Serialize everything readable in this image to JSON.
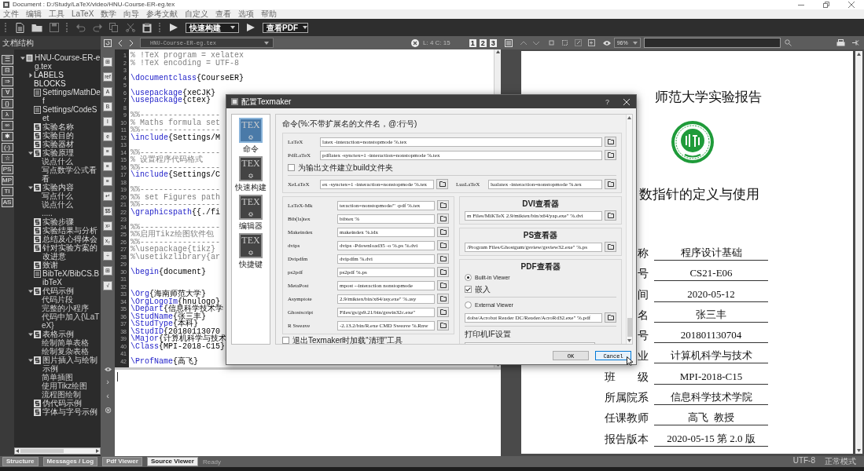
{
  "window": {
    "title": "Document : D:/Study/LaTeX/video/HNU-Course-ER-eg.tex"
  },
  "menu": [
    "文件",
    "编辑",
    "工具",
    "LaTeX",
    "数学",
    "向导",
    "参考文献",
    "自定义",
    "查看",
    "选项",
    "帮助"
  ],
  "toolbar": {
    "build_command": "快速构建",
    "view_command": "查看PDF"
  },
  "tabbar": {
    "file_tab": "HNU-Course-ER-eg.tex",
    "cursor_position": "L: 4 C: 15",
    "page_layouts": [
      "1",
      "2",
      "3"
    ],
    "zoom": "96%"
  },
  "structure": {
    "title": "文档结构",
    "symbols": [
      "☰",
      "⊟",
      "⇒",
      "∀",
      "{}",
      "λ",
      "∞",
      "✱",
      "(·)",
      "☆",
      "PS",
      "MP",
      "TI",
      "AS"
    ],
    "tree": [
      {
        "label": "HNU-Course-ER-eg.tex",
        "kind": "file",
        "expanded": true,
        "children": [
          {
            "label": "LABELS",
            "kind": "group",
            "expanded": false
          },
          {
            "label": "BLOCKS",
            "kind": "group"
          },
          {
            "label": "Settings/MathDef",
            "kind": "include"
          },
          {
            "label": "Settings/CodeSet",
            "kind": "include"
          },
          {
            "label": "实验名称",
            "kind": "section"
          },
          {
            "label": "实验目的",
            "kind": "section"
          },
          {
            "label": "实验器材",
            "kind": "section"
          },
          {
            "label": "实验原理",
            "kind": "section",
            "expanded": true,
            "children": [
              {
                "label": "说点什么",
                "kind": "item"
              },
              {
                "label": "写点数学公式看看",
                "kind": "item"
              }
            ]
          },
          {
            "label": "实验内容",
            "kind": "section",
            "expanded": true,
            "children": [
              {
                "label": "写点什么",
                "kind": "item"
              },
              {
                "label": "说点什么",
                "kind": "item"
              },
              {
                "label": ".....",
                "kind": "item"
              }
            ]
          },
          {
            "label": "实验步骤",
            "kind": "section"
          },
          {
            "label": "实验结果与分析",
            "kind": "section"
          },
          {
            "label": "总结及心得体会",
            "kind": "section"
          },
          {
            "label": "针对实验方案的改进意",
            "kind": "section"
          },
          {
            "label": "致谢",
            "kind": "section"
          },
          {
            "label": "BibTeX/BibCS.BibTeX",
            "kind": "include"
          },
          {
            "label": "代码示例",
            "kind": "section",
            "expanded": true,
            "children": [
              {
                "label": "代码片段",
                "kind": "item"
              },
              {
                "label": "完整的小程序",
                "kind": "item"
              },
              {
                "label": "代码中加入{\\LaTeX}",
                "kind": "item"
              }
            ]
          },
          {
            "label": "表格示例",
            "kind": "section",
            "expanded": true,
            "children": [
              {
                "label": "绘制简单表格",
                "kind": "item"
              },
              {
                "label": "绘制复杂表格",
                "kind": "item"
              }
            ]
          },
          {
            "label": "图片插入与绘制示例",
            "kind": "section",
            "expanded": true,
            "children": [
              {
                "label": "简单插图",
                "kind": "item"
              },
              {
                "label": "使用Tikz绘图",
                "kind": "item"
              },
              {
                "label": "流程图绘制",
                "kind": "item"
              }
            ]
          },
          {
            "label": "伪代码示例",
            "kind": "section"
          },
          {
            "label": "字体与字号示例",
            "kind": "section"
          }
        ]
      }
    ]
  },
  "editor_strip": {
    "tools": [
      "⊞",
      "ref",
      "A",
      "B",
      "I",
      "e",
      "≡",
      "≡",
      "≡",
      "↵",
      "$$",
      "x²",
      "x₂",
      "÷",
      "⊞",
      "√"
    ],
    "panel_toggles": [
      "›",
      "‹",
      "⊗"
    ]
  },
  "editor": {
    "lines": [
      {
        "n": "1",
        "t": "% !TeX program = xelatex",
        "kind": "comment"
      },
      {
        "n": "2",
        "t": "% !TeX encoding = UTF-8",
        "kind": "comment"
      },
      {
        "n": "3"
      },
      {
        "n": "4",
        "t": "\\documentclass{CourseER}",
        "kind": "command"
      },
      {
        "n": "5"
      },
      {
        "n": "6",
        "t": "\\usepackage{xeCJK}",
        "kind": "command"
      },
      {
        "n": "7",
        "t": "\\usepackage{ctex}",
        "kind": "command"
      },
      {
        "n": "8"
      },
      {
        "n": "9",
        "t": "%%-----------------",
        "kind": "comment"
      },
      {
        "n": "10",
        "t": "% Maths formula set",
        "kind": "comment"
      },
      {
        "n": "11",
        "t": "%%-----------------",
        "kind": "comment"
      },
      {
        "n": "12",
        "t": "\\include{Settings/M",
        "kind": "command"
      },
      {
        "n": "13"
      },
      {
        "n": "14",
        "t": "%%-----------------",
        "kind": "comment"
      },
      {
        "n": "15",
        "t": "% 设置程序代码格式",
        "kind": "comment"
      },
      {
        "n": "16",
        "t": "%%-----------------",
        "kind": "comment"
      },
      {
        "n": "17",
        "t": "\\include{Settings/C",
        "kind": "command"
      },
      {
        "n": "18"
      },
      {
        "n": "19",
        "t": "%%-----------------",
        "kind": "comment"
      },
      {
        "n": "20",
        "t": "%% set Figures path",
        "kind": "comment"
      },
      {
        "n": "21",
        "t": "%%-----------------",
        "kind": "comment"
      },
      {
        "n": "22",
        "t": "\\graphicspath{{./fi",
        "kind": "command"
      },
      {
        "n": "23"
      },
      {
        "n": "24",
        "t": "%%-----------------",
        "kind": "comment"
      },
      {
        "n": "25",
        "t": "%%启用Tikz绘图软件包",
        "kind": "comment"
      },
      {
        "n": "26",
        "t": "%%-----------------",
        "kind": "comment"
      },
      {
        "n": "27",
        "t": "%\\usepackage{tikz}",
        "kind": "comment"
      },
      {
        "n": "28",
        "t": "%\\usetikzlibrary{ar",
        "kind": "comment"
      },
      {
        "n": "29"
      },
      {
        "n": "30",
        "t": "\\begin{document}",
        "kind": "command"
      },
      {
        "n": "31"
      },
      {
        "n": "32"
      },
      {
        "n": "33",
        "t": "\\Org{海南师范大学}",
        "kind": "command"
      },
      {
        "n": "34",
        "t": "\\OrgLogoIm{hnulogo}",
        "kind": "command"
      },
      {
        "n": "35",
        "t": "\\Depart{信息科学技术学",
        "kind": "command"
      },
      {
        "n": "36",
        "t": "\\StudName{张三丰}",
        "kind": "command"
      },
      {
        "n": "37",
        "t": "\\StudType{本科}",
        "kind": "command"
      },
      {
        "n": "38",
        "t": "\\StudID{20180113070",
        "kind": "command"
      },
      {
        "n": "39",
        "t": "\\Major{计算机科学与技术",
        "kind": "command"
      },
      {
        "n": "40",
        "t": "\\Class{MPI-2018-C15}",
        "kind": "command"
      },
      {
        "n": "41"
      },
      {
        "n": "42",
        "t": "\\ProfName{高飞}",
        "kind": "command"
      }
    ]
  },
  "pdf_page": {
    "title": "师范大学实验报告",
    "subtitle": "数指针的定义与使用",
    "fields": [
      {
        "label": "称",
        "value": "程序设计基础"
      },
      {
        "label": "号",
        "value": "CS21-E06"
      },
      {
        "label": "间",
        "value": "2020-05-12"
      },
      {
        "label": "名",
        "value": "张三丰"
      },
      {
        "label": "号",
        "value": "201801130704"
      },
      {
        "label": "业",
        "value": "计算机科学与技术"
      },
      {
        "label": "班　　级",
        "value": "MPI-2018-C15"
      },
      {
        "label": "所属院系",
        "value": "信息科学技术学院"
      },
      {
        "label": "任课教师",
        "value": "高飞  教授"
      },
      {
        "label": "报告版本",
        "value": "2020-05-15 第 2.0 版"
      }
    ]
  },
  "dialog": {
    "title": "配置Texmaker",
    "help": "?",
    "categories": [
      {
        "label": "命令",
        "logo": "TEX",
        "selected": true
      },
      {
        "label": "快速构建",
        "logo": "TEX",
        "selected": false
      },
      {
        "label": "编辑器",
        "logo": "TEX",
        "selected": false
      },
      {
        "label": "快捷键",
        "logo": "TEX",
        "selected": false
      }
    ],
    "heading": "命令(%:不带扩展名的文件名，@:行号)",
    "main_commands": [
      {
        "label": "LaTeX",
        "value": "latex -interaction=nonstopmode %.tex"
      },
      {
        "label": "PdfLaTeX",
        "value": "pdflatex -synctex=1 -interaction=nonstopmode %.tex"
      }
    ],
    "build_folder": {
      "label": "为输出文件建立build文件夹",
      "checked": false
    },
    "engines": [
      {
        "label": "XeLaTeX",
        "value": "ex -synctex=1 -interaction=nonstopmode %.tex"
      },
      {
        "label": "LuaLaTeX",
        "value": "lualatex -interaction=nonstopmode %.tex"
      }
    ],
    "tools": [
      {
        "label": "LaTeX-Mk",
        "value": "teraction=nonstopmode/\" -pdf %.tex"
      },
      {
        "label": "Bib(la)tex",
        "value": "bibtex %"
      },
      {
        "label": "Makeindex",
        "value": "makeindex %.idx"
      },
      {
        "label": "dvips",
        "value": "dvips -Pdownload35 -o %.ps %.dvi"
      },
      {
        "label": "Dvipdfm",
        "value": "dvipdfm %.dvi"
      },
      {
        "label": "ps2pdf",
        "value": "ps2pdf %.ps"
      },
      {
        "label": "MetaPost",
        "value": "mpost --interaction nonstopmode"
      },
      {
        "label": "Asymptote",
        "value": "2.9/miktex/bin/x64/asy.exe\" %.asy"
      },
      {
        "label": "Ghostscript",
        "value": "Files/gs/gs9.21/bin/gswin32c.exe\""
      },
      {
        "label": "R Sweave",
        "value": "-2.13.2/bin/R.exe CMD Sweave %.Rnw"
      }
    ],
    "cleanup": {
      "label": "退出Texmaker时加载“清理”工具",
      "checked": false
    },
    "dvi_viewer": {
      "title": "DVI查看器",
      "value": "m Files/MiKTeX 2.9/miktex/bin/x64/yap.exe\" %.dvi"
    },
    "ps_viewer": {
      "title": "PS查看器",
      "value": "/Program Files/Ghostgum/gsview/gsview32.exe\" %.ps"
    },
    "pdf_viewer": {
      "title": "PDF查看器",
      "builtin": {
        "label": "Built-in Viewer",
        "selected": true
      },
      "embed": {
        "label": "嵌入",
        "checked": true
      },
      "external": {
        "label": "External Viewer",
        "selected": false
      },
      "value": "dobe/Acrobat Reader DC/Reader/AcroRd32.exe\" %.pdf",
      "printer_label": "打印机IF设置"
    },
    "buttons": [
      {
        "label": "OK",
        "focused": false
      },
      {
        "label": "Cancel",
        "focused": true
      }
    ]
  },
  "bottom_tabs": [
    {
      "label": "Structure",
      "selected": false
    },
    {
      "label": "Messages / Log",
      "selected": false
    },
    {
      "label": "Pdf Viewer",
      "selected": false
    },
    {
      "label": "Source Viewer",
      "selected": true
    }
  ],
  "status": {
    "text": "Ready",
    "encoding": "UTF-8",
    "mode": "正常模式"
  }
}
